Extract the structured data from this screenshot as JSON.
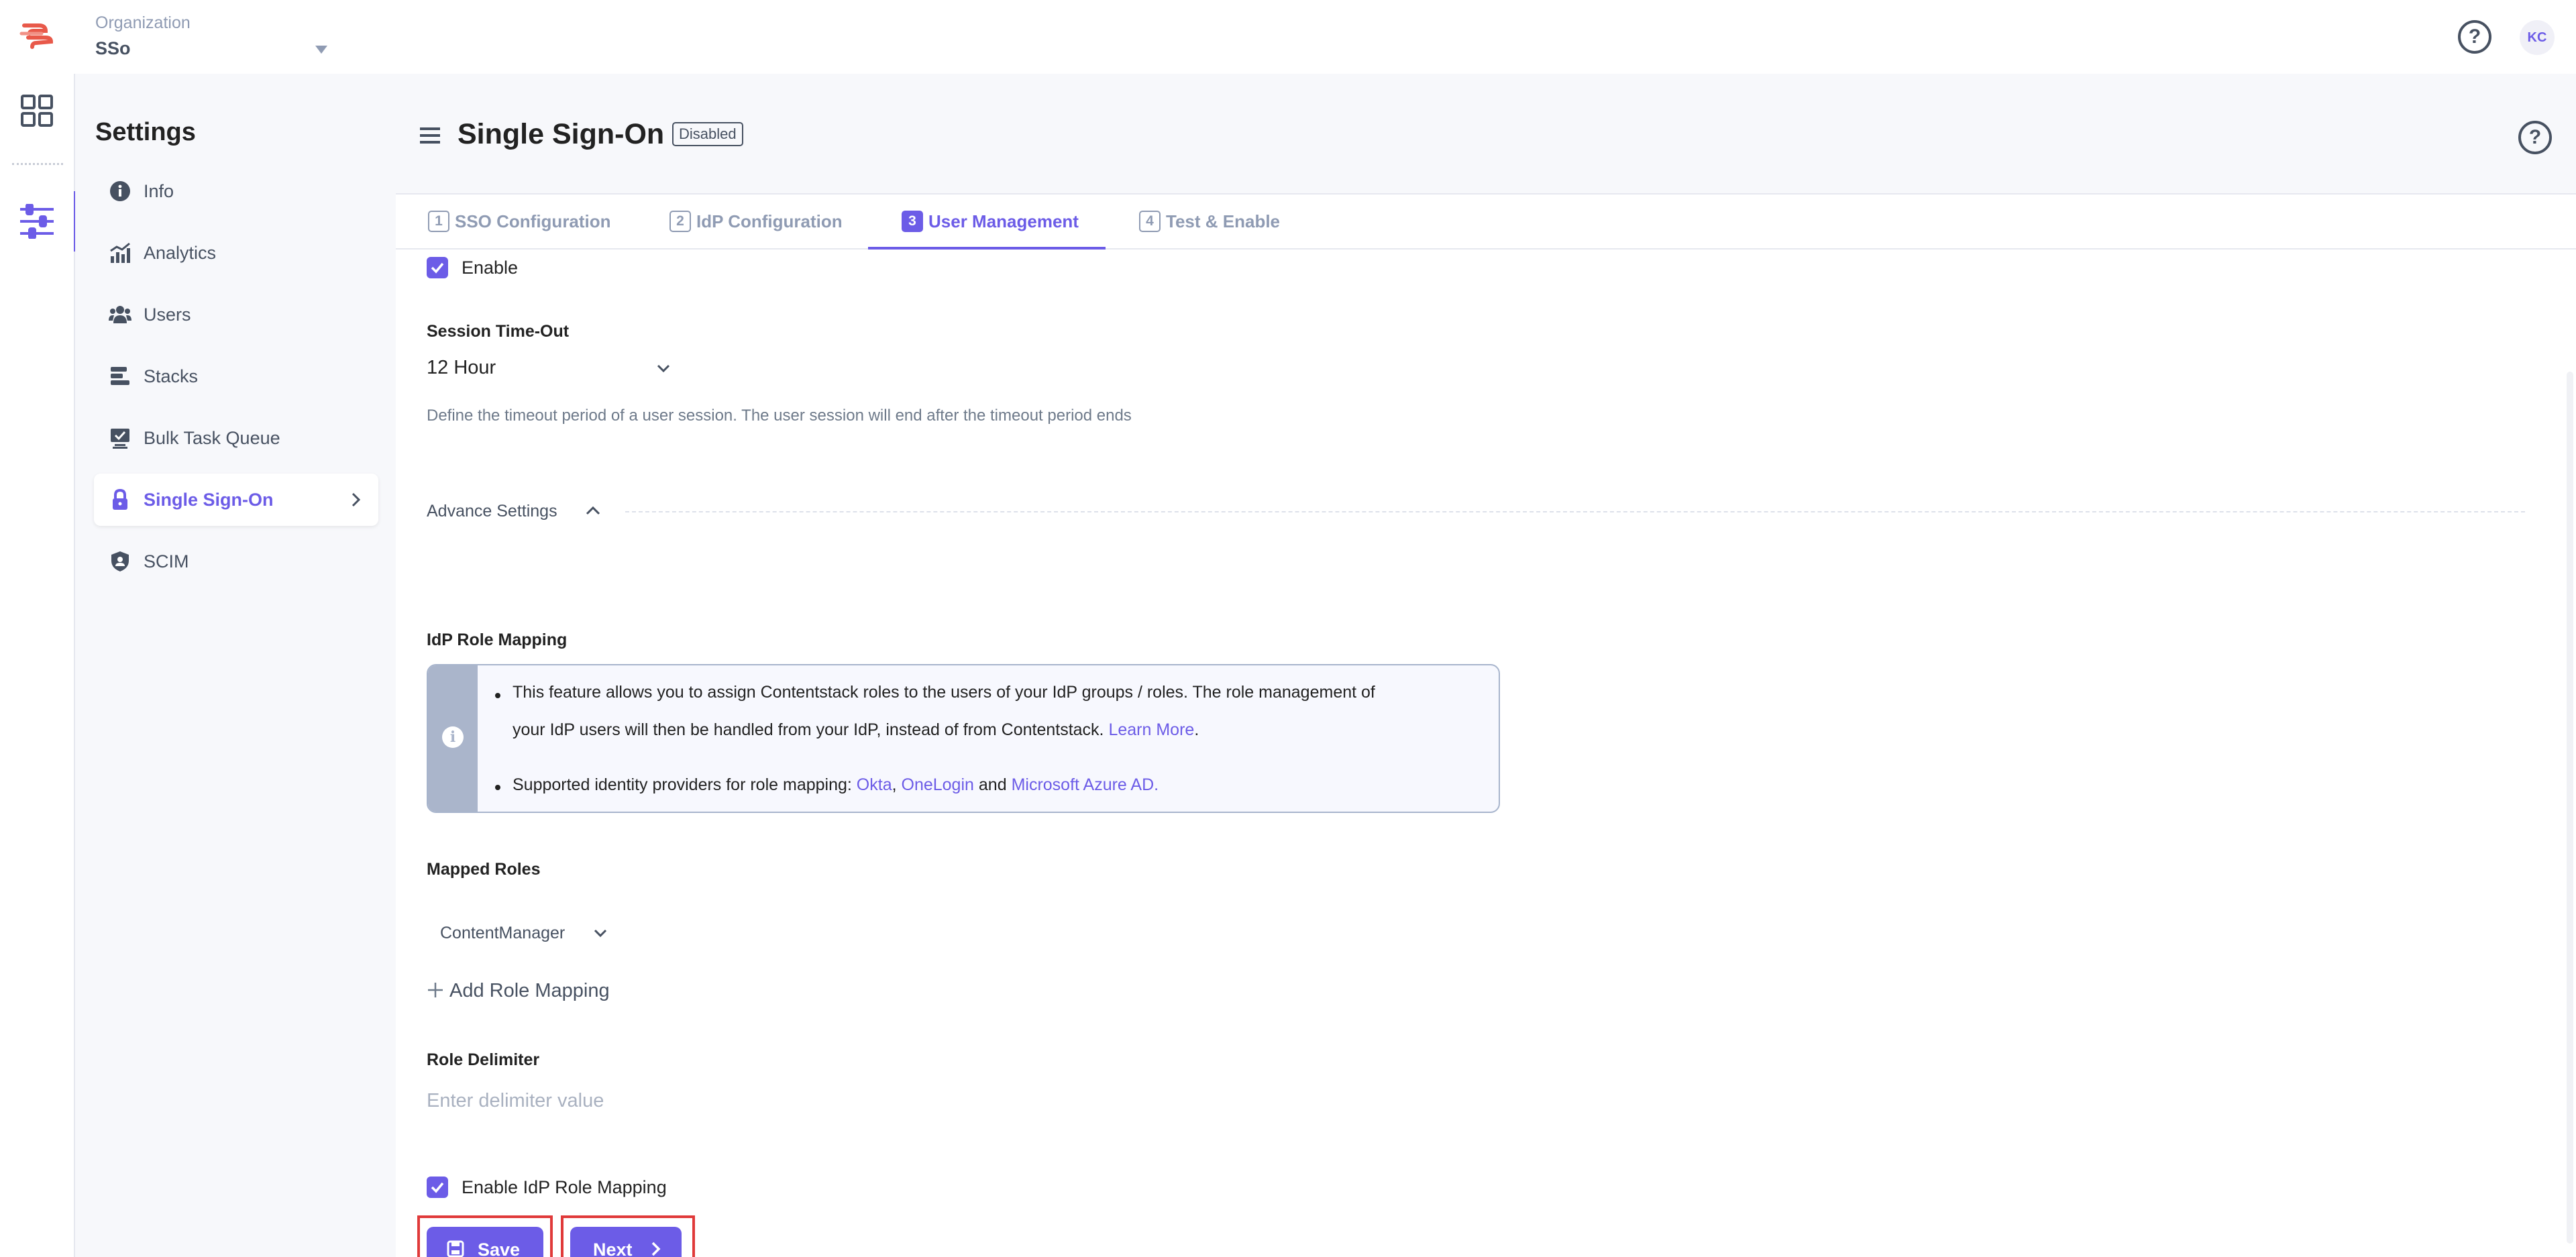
{
  "org": {
    "label": "Organization",
    "value": "SSo"
  },
  "user": {
    "initials": "KC"
  },
  "sidebar": {
    "title": "Settings",
    "items": [
      {
        "label": "Info",
        "icon": "info-icon"
      },
      {
        "label": "Analytics",
        "icon": "analytics-icon"
      },
      {
        "label": "Users",
        "icon": "users-icon"
      },
      {
        "label": "Stacks",
        "icon": "stacks-icon"
      },
      {
        "label": "Bulk Task Queue",
        "icon": "bulk-task-icon"
      },
      {
        "label": "Single Sign-On",
        "icon": "lock-icon",
        "active": true
      },
      {
        "label": "SCIM",
        "icon": "shield-icon"
      }
    ]
  },
  "page": {
    "title": "Single Sign-On",
    "status": "Disabled"
  },
  "tabs": [
    {
      "num": "1",
      "label": "SSO Configuration"
    },
    {
      "num": "2",
      "label": "IdP Configuration"
    },
    {
      "num": "3",
      "label": "User Management",
      "active": true
    },
    {
      "num": "4",
      "label": "Test & Enable"
    }
  ],
  "form": {
    "enable_label": "Enable",
    "session_timeout": {
      "label": "Session Time-Out",
      "value": "12 Hour",
      "help": "Define the timeout period of a user session. The user session will end after the timeout period ends"
    },
    "advance_settings_label": "Advance Settings",
    "role_mapping": {
      "label": "IdP Role Mapping",
      "notice_line1": "This feature allows you to assign Contentstack roles to the users of your IdP groups / roles. The role management of",
      "notice_line2_text": "your IdP users will then be handled from your IdP, instead of from Contentstack.",
      "learn_more": "Learn More",
      "period": ".",
      "notice_line3_text": "Supported identity providers for role mapping:",
      "okta": "Okta",
      "comma": ",",
      "onelogin": "OneLogin",
      "and": "and",
      "azure": "Microsoft Azure AD."
    },
    "mapped_roles": {
      "label": "Mapped Roles",
      "value": "ContentManager"
    },
    "add_role_mapping": "Add Role Mapping",
    "role_delimiter": {
      "label": "Role Delimiter",
      "placeholder": "Enter delimiter value"
    },
    "enable_role_mapping_label": "Enable IdP Role Mapping"
  },
  "buttons": {
    "save": "Save",
    "next": "Next"
  },
  "colors": {
    "accent": "#6c5ce7",
    "highlight": "#e03a3a",
    "brand": "#e8594a"
  }
}
